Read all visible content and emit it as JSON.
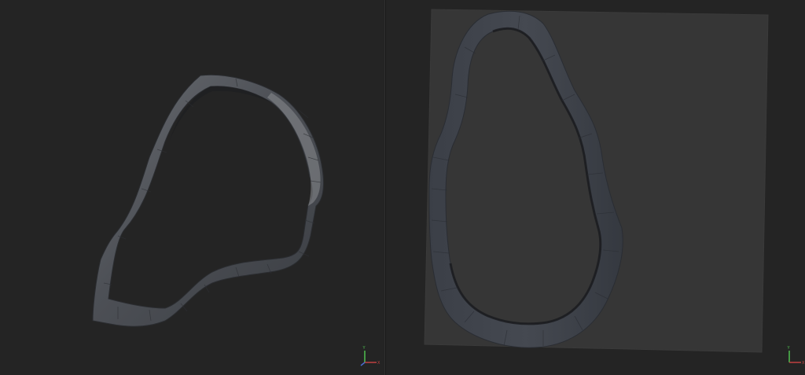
{
  "viewports": [
    {
      "id": "3d-view",
      "mesh": "patch-ring",
      "background": "#242424",
      "mesh_color": "#5a5d62"
    },
    {
      "id": "2d-uv-view",
      "mesh": "uv-ring",
      "background": "#242424",
      "uv_plane_color": "#363636",
      "mesh_color": "#3f434b"
    }
  ],
  "axis_gizmo": {
    "icon": "axis-gizmo-icon",
    "y_label": "Y",
    "x_label": "X",
    "colors": {
      "x": "#c04040",
      "y": "#4fbf4f",
      "z": "#4a6ad0"
    }
  }
}
